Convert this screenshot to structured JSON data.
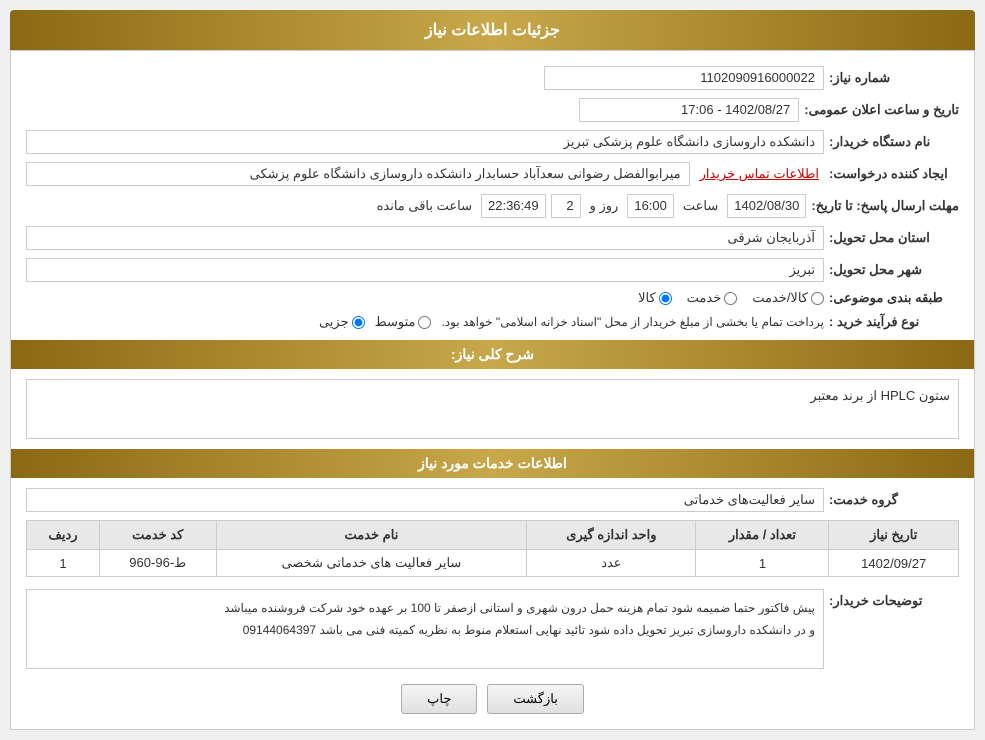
{
  "header": {
    "title": "جزئیات اطلاعات نیاز"
  },
  "fields": {
    "shomare_niaz_label": "شماره نیاز:",
    "shomare_niaz_value": "1102090916000022",
    "nam_dastgah_label": "نام دستگاه خریدار:",
    "nam_dastgah_value": "دانشکده داروسازی دانشگاه علوم پزشکی تبریز",
    "ijad_konande_label": "ایجاد کننده درخواست:",
    "ijad_konande_value": "میرابوالفضل رضوانی سعدآباد حسابدار دانشکده داروسازی دانشگاه علوم پزشکی",
    "etelaat_tamas_label": "اطلاعات تماس خریدار",
    "mohlat_label": "مهلت ارسال پاسخ: تا تاریخ:",
    "date_value": "1402/08/30",
    "saat_label": "ساعت",
    "saat_value": "16:00",
    "rooz_label": "روز و",
    "rooz_value": "2",
    "baqi_label": "ساعت باقی مانده",
    "baqi_value": "22:36:49",
    "tarikh_elan_label": "تاریخ و ساعت اعلان عمومی:",
    "tarikh_elan_value": "1402/08/27 - 17:06",
    "ostan_label": "استان محل تحویل:",
    "ostan_value": "آذربایجان شرقی",
    "shahr_label": "شهر محل تحویل:",
    "shahr_value": "تبریز",
    "tabaqe_label": "طبقه بندی موضوعی:",
    "tabaqe_kala": "کالا",
    "tabaqe_khadamat": "خدمت",
    "tabaqe_kala_khadamat": "کالا/خدمت",
    "now_farayand_label": "نوع فرآیند خرید :",
    "now_jozii": "جزیی",
    "now_motavaset": "متوسط",
    "now_note": "پرداخت تمام یا بخشی از مبلغ خریدار از محل \"اسناد خزانه اسلامی\" خواهد بود.",
    "sharh_label": "شرح کلی نیاز:",
    "sharh_value": "ستون HPLC از برند معتبر",
    "service_section_label": "اطلاعات خدمات مورد نیاز",
    "group_label": "گروه خدمت:",
    "group_value": "سایر فعالیت‌های خدماتی",
    "table_headers": [
      "ردیف",
      "کد خدمت",
      "نام خدمت",
      "واحد اندازه گیری",
      "تعداد / مقدار",
      "تاریخ نیاز"
    ],
    "table_rows": [
      {
        "row": "1",
        "code": "ط-96-960",
        "name": "سایر فعالیت های خدماتی شخصی",
        "unit": "عدد",
        "count": "1",
        "date": "1402/09/27"
      }
    ],
    "tawzih_label": "توضیحات خریدار:",
    "tawzih_value": "پیش فاکتور حتما ضمیمه شود تمام هزینه حمل درون شهری و استانی ازصفر تا 100 بر عهده خود شرکت فروشنده  میباشد\nو در دانشکده داروسازی تبریز تحویل داده شود تائید نهایی استعلام منوط به نظریه کمیته فنی می باشد   09144064397",
    "btn_print": "چاپ",
    "btn_back": "بازگشت"
  }
}
